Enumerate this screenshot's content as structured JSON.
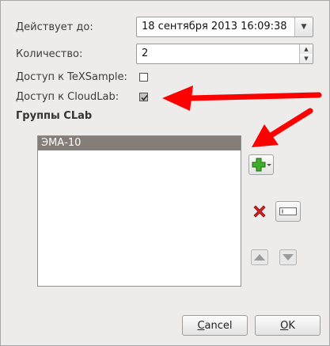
{
  "form": {
    "valid_until_label": "Действует до:",
    "valid_until_value": "18 сентября 2013 16:09:38",
    "quantity_label": "Количество:",
    "quantity_value": "2",
    "texsample_label": "Доступ к TeXSample:",
    "texsample_checked": false,
    "cloudlab_label": "Доступ к CloudLab:",
    "cloudlab_checked": true
  },
  "groups": {
    "title": "Группы CLab",
    "items": [
      {
        "label": "ЭМА-10",
        "selected": true
      }
    ]
  },
  "icons": {
    "add": "plus-icon",
    "remove": "red-x-icon",
    "rename": "rename-field-icon",
    "up": "arrow-up-icon",
    "down": "arrow-down-icon"
  },
  "colors": {
    "annotation_arrow": "#ff0000",
    "selection": "#857d77",
    "window_bg": "#edeceb",
    "add_icon": "#2f9a1f",
    "remove_icon": "#d31d1d"
  },
  "buttons": {
    "cancel": "Cancel",
    "cancel_mnemonic": "C",
    "ok": "OK",
    "ok_mnemonic": "O"
  }
}
